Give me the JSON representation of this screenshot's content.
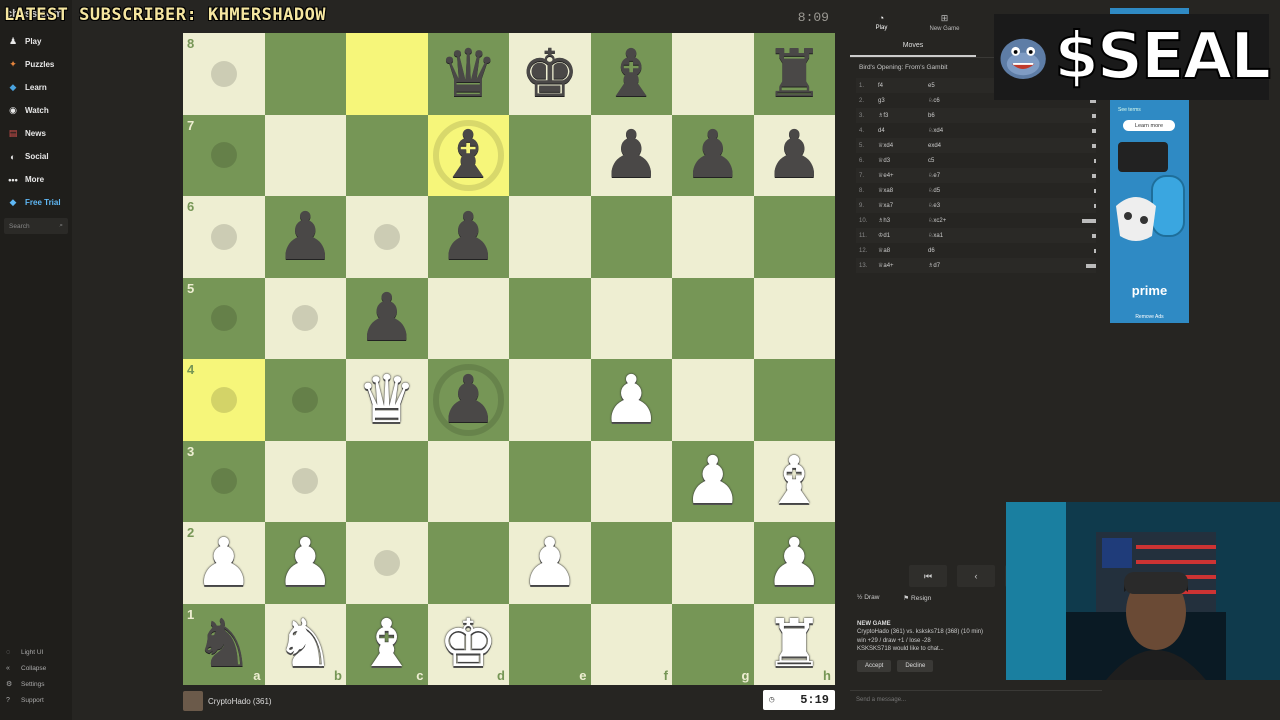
{
  "overlay": {
    "subscriber_text": "LATEST SUBSCRIBER: KHMERSHADOW"
  },
  "sidebar": {
    "logo": "chess.com",
    "items": [
      {
        "label": "Play",
        "icon": "play-icon"
      },
      {
        "label": "Puzzles",
        "icon": "puzzle-icon"
      },
      {
        "label": "Learn",
        "icon": "learn-icon"
      },
      {
        "label": "Watch",
        "icon": "watch-icon"
      },
      {
        "label": "News",
        "icon": "news-icon"
      },
      {
        "label": "Social",
        "icon": "social-icon"
      },
      {
        "label": "More",
        "icon": "more-icon"
      },
      {
        "label": "Free Trial",
        "icon": "diamond-icon"
      }
    ],
    "search_placeholder": "Search",
    "bottom": [
      {
        "label": "Light UI"
      },
      {
        "label": "Collapse"
      },
      {
        "label": "Settings"
      },
      {
        "label": "Support"
      }
    ]
  },
  "board": {
    "opponent_timer": "8:09",
    "player_name": "CryptoHado (361)",
    "player_timer": "5:19",
    "ranks": [
      "8",
      "7",
      "6",
      "5",
      "4",
      "3",
      "2",
      "1"
    ],
    "files": [
      "a",
      "b",
      "c",
      "d",
      "e",
      "f",
      "g",
      "h"
    ],
    "position": [
      [
        null,
        null,
        null,
        "bq",
        "bk",
        "bb",
        null,
        "br"
      ],
      [
        null,
        null,
        null,
        "bb",
        null,
        "bp",
        "bp",
        "bp"
      ],
      [
        null,
        "bp",
        null,
        "bp",
        null,
        null,
        null,
        null
      ],
      [
        null,
        null,
        "bp",
        null,
        null,
        null,
        null,
        null
      ],
      [
        null,
        null,
        "wq",
        "bp",
        null,
        "wp",
        null,
        null
      ],
      [
        null,
        null,
        null,
        null,
        null,
        null,
        "wp",
        "wb"
      ],
      [
        "wp",
        "wp",
        null,
        null,
        "wp",
        null,
        null,
        "wp"
      ],
      [
        "bn",
        "wn",
        "wb",
        "wk",
        null,
        null,
        null,
        "wr"
      ]
    ],
    "highlights": [
      "c8",
      "d7",
      "a4"
    ],
    "dots": [
      "a8",
      "a7",
      "a6",
      "c6",
      "a5",
      "b5",
      "a4",
      "b4",
      "a3",
      "b3",
      "c2"
    ],
    "rings": [
      "d7",
      "d4"
    ]
  },
  "panel": {
    "tabs": [
      {
        "label": "Play",
        "icon": "clock-icon"
      },
      {
        "label": "New Game",
        "icon": "plus-icon"
      },
      {
        "label": "",
        "icon": "games-icon"
      },
      {
        "label": "",
        "icon": "players-icon"
      }
    ],
    "subtabs": [
      "Moves",
      ""
    ],
    "opening": "Bird's Opening: From's Gambit",
    "moves": [
      {
        "n": "1.",
        "w": "f4",
        "b": "e5",
        "bar": 0.3
      },
      {
        "n": "2.",
        "w": "g3",
        "b": "♘c6",
        "bar": 0.3
      },
      {
        "n": "3.",
        "w": "♗f3",
        "b": "b6",
        "bar": 0.2
      },
      {
        "n": "4.",
        "w": "d4",
        "b": "♘xd4",
        "bar": 0.2
      },
      {
        "n": "5.",
        "w": "♕xd4",
        "b": "exd4",
        "bar": 0.2
      },
      {
        "n": "6.",
        "w": "♕d3",
        "b": "c5",
        "bar": 0.1
      },
      {
        "n": "7.",
        "w": "♕e4+",
        "b": "♘e7",
        "bar": 0.2
      },
      {
        "n": "8.",
        "w": "♕xa8",
        "b": "♘d5",
        "bar": 0.1
      },
      {
        "n": "9.",
        "w": "♕xa7",
        "b": "♘e3",
        "bar": 0.1
      },
      {
        "n": "10.",
        "w": "♗h3",
        "b": "♘xc2+",
        "bar": 0.7
      },
      {
        "n": "11.",
        "w": "♔d1",
        "b": "♘xa1",
        "bar": 0.2
      },
      {
        "n": "12.",
        "w": "♕a8",
        "b": "d6",
        "bar": 0.1
      },
      {
        "n": "13.",
        "w": "♕a4+",
        "b": "♗d7",
        "bar": 0.5
      }
    ],
    "draw_label": "Draw",
    "resign_label": "Resign",
    "new_game": {
      "title": "NEW GAME",
      "line1": "CryptoHado (361) vs. ksksks718 (368) (10 min)",
      "line2": "win +29 / draw +1 / lose -28",
      "line3": "KSKSKS718 would like to chat...",
      "accept": "Accept",
      "decline": "Decline"
    },
    "chat_placeholder": "Send a message..."
  },
  "ad": {
    "terms": "See terms",
    "learn_more": "Learn more",
    "brand": "prime",
    "remove": "Remove Ads"
  },
  "seal": {
    "text": "$SEAL"
  }
}
